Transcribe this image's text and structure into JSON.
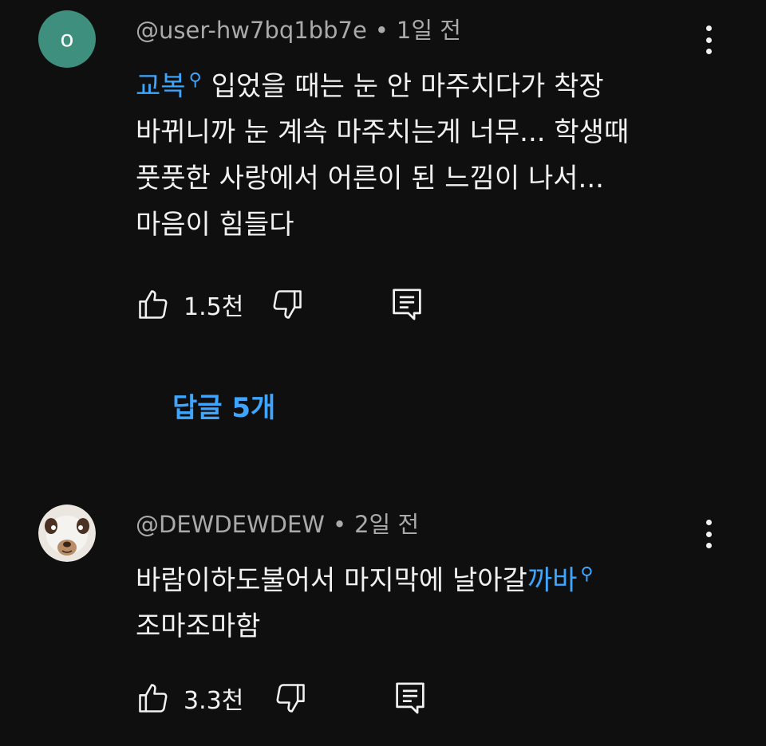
{
  "comments": [
    {
      "avatar_letter": "o",
      "avatar_color": "#3f8f7f",
      "author": "@user-hw7bq1bb7e",
      "separator": "•",
      "time": "1일 전",
      "hashtag": "교복",
      "search_symbol": "⚲",
      "text_lines": [
        "입었을 때는 눈 안 마주치다가 착장",
        "바뀌니까 눈 계속 마주치는게 너무... 학생때",
        "풋풋한 사랑에서 어른이 된 느낌이 나서...",
        "마음이 힘들다"
      ],
      "likes": "1.5천",
      "replies_label": "답글 5개"
    },
    {
      "avatar_icon": "bear-mask-avatar",
      "author": "@DEWDEWDEW",
      "separator": "•",
      "time": "2일 전",
      "text_prefix": "바람이하도불어서 마지막에 날아갈",
      "hashtag": "까바",
      "search_symbol": "⚲",
      "text_line2": "조마조마함",
      "likes": "3.3천"
    }
  ],
  "colors": {
    "background": "#0f0f0f",
    "text": "#f1f1f1",
    "meta": "#aaaaaa",
    "accent": "#3ea6ff"
  }
}
